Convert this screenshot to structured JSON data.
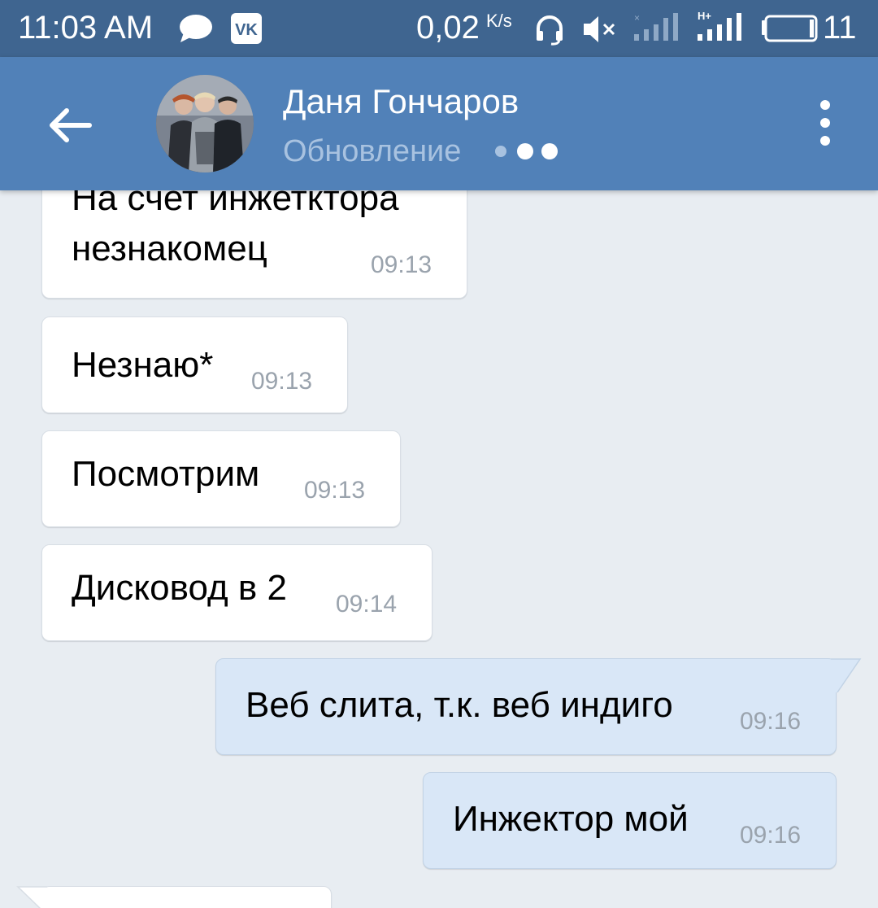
{
  "status_bar": {
    "time": "11:03 AM",
    "speed": "0,02",
    "speed_unit": "K/s",
    "battery": "11",
    "icons": [
      "chat-bubble-icon",
      "vk-icon",
      "headset-icon",
      "muted-speaker-icon",
      "no-signal-icon",
      "signal-hplus-icon",
      "battery-icon"
    ]
  },
  "header": {
    "contact_name": "Даня Гончаров",
    "status": "Обновление"
  },
  "messages": [
    {
      "direction": "in",
      "lines": [
        "На счет инжетктора",
        "незнакомец"
      ],
      "time": "09:13"
    },
    {
      "direction": "in",
      "lines": [
        "Незнаю*"
      ],
      "time": "09:13"
    },
    {
      "direction": "in",
      "lines": [
        "Посмотрим"
      ],
      "time": "09:13"
    },
    {
      "direction": "in",
      "lines": [
        "Дисковод в 2"
      ],
      "time": "09:14"
    },
    {
      "direction": "out",
      "lines": [
        "Веб слита, т.к. веб индиго"
      ],
      "time": "09:16"
    },
    {
      "direction": "out",
      "lines": [
        "Инжектор мой"
      ],
      "time": "09:16"
    }
  ],
  "colors": {
    "status_bar": "#3f6590",
    "header": "#5181b8",
    "chat_bg": "#e8edf2",
    "incoming_bubble": "#ffffff",
    "outgoing_bubble": "#d9e7f7"
  }
}
